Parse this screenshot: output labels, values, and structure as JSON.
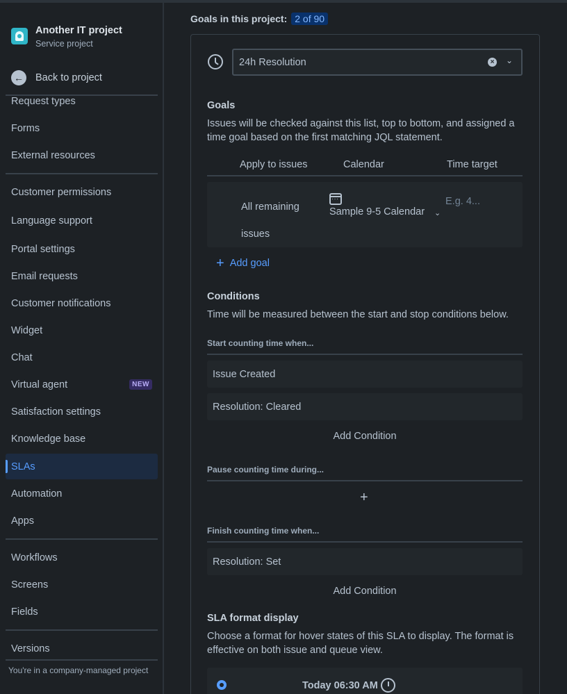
{
  "project": {
    "name": "Another IT project",
    "type": "Service project"
  },
  "back_label": "Back to project",
  "sidebar": {
    "items": [
      {
        "label": "Request types"
      },
      {
        "label": "Forms"
      },
      {
        "label": "External resources"
      },
      {
        "label": "Customer permissions"
      },
      {
        "label": "Language support"
      },
      {
        "label": "Portal settings"
      },
      {
        "label": "Email requests"
      },
      {
        "label": "Customer notifications"
      },
      {
        "label": "Widget"
      },
      {
        "label": "Chat"
      },
      {
        "label": "Virtual agent",
        "badge": "NEW"
      },
      {
        "label": "Satisfaction settings"
      },
      {
        "label": "Knowledge base"
      },
      {
        "label": "SLAs",
        "active": true
      },
      {
        "label": "Automation"
      },
      {
        "label": "Apps"
      },
      {
        "label": "Workflows"
      },
      {
        "label": "Screens"
      },
      {
        "label": "Fields"
      },
      {
        "label": "Versions"
      }
    ],
    "footer": "You're in a company-managed project"
  },
  "goals_header": {
    "label": "Goals in this project:",
    "count": "2 of 90"
  },
  "sla_select": {
    "value": "24h Resolution"
  },
  "goals": {
    "heading": "Goals",
    "description": "Issues will be checked against this list, top to bottom, and assigned a time goal based on the first matching JQL statement.",
    "columns": [
      "Apply to issues",
      "Calendar",
      "Time target"
    ],
    "row": {
      "apply": "All remaining issues",
      "calendar": "Sample 9-5 Calendar",
      "time_placeholder": "E.g. 4..."
    },
    "add_label": "Add goal"
  },
  "conditions": {
    "heading": "Conditions",
    "description": "Time will be measured between the start and stop conditions below.",
    "start_label": "Start counting time when...",
    "start_items": [
      "Issue Created",
      "Resolution: Cleared"
    ],
    "pause_label": "Pause counting time during...",
    "finish_label": "Finish counting time when...",
    "finish_items": [
      "Resolution: Set"
    ],
    "add_condition": "Add Condition"
  },
  "format": {
    "heading": "SLA format display",
    "description": "Choose a format for hover states of this SLA to display. The format is effective on both issue and queue view.",
    "option_text": "Today 06:30 AM"
  },
  "colors": {
    "background": "#1d2125",
    "accent": "#579dff",
    "surface": "#22272b"
  }
}
